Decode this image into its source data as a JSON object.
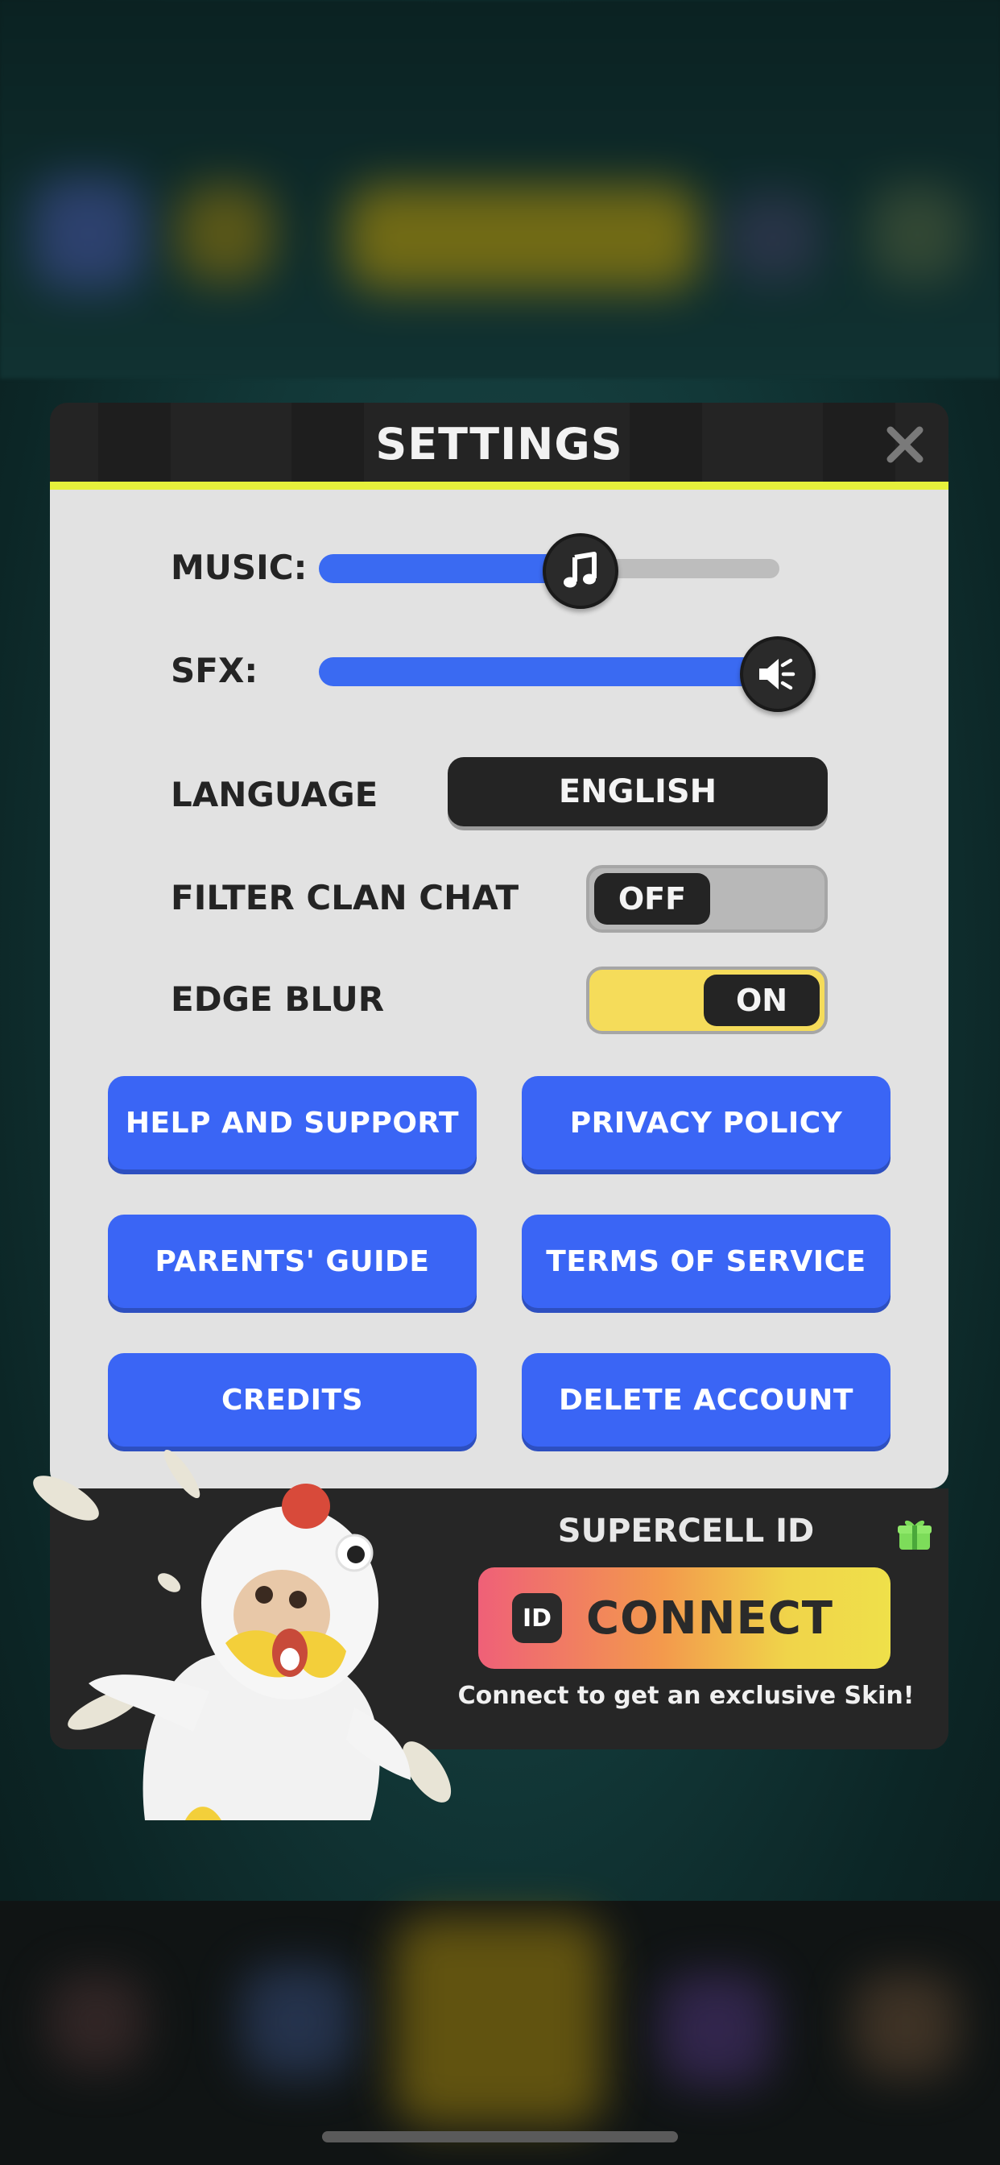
{
  "settings": {
    "title": "SETTINGS",
    "music": {
      "label": "MUSIC:",
      "level": 0.57
    },
    "sfx": {
      "label": "SFX:",
      "level": 1.0
    },
    "language": {
      "label": "LANGUAGE",
      "value": "ENGLISH"
    },
    "filter_clan_chat": {
      "label": "FILTER CLAN CHAT",
      "state": "OFF"
    },
    "edge_blur": {
      "label": "EDGE BLUR",
      "state": "ON"
    },
    "buttons": {
      "help": "HELP AND SUPPORT",
      "privacy": "PRIVACY POLICY",
      "parents": "PARENTS' GUIDE",
      "terms": "TERMS OF SERVICE",
      "credits": "CREDITS",
      "delete": "DELETE ACCOUNT"
    }
  },
  "supercell_id": {
    "title": "SUPERCELL ID",
    "badge": "ID",
    "connect_label": "CONNECT",
    "note": "Connect to get an exclusive Skin!"
  },
  "colors": {
    "accent_yellow": "#e6f03c",
    "button_blue": "#3a65f5",
    "slider_blue": "#3a6af2",
    "panel_dark": "#242424",
    "panel_light": "#e2e2e2",
    "toggle_on": "#f5dc5a",
    "gift_green": "#7ddc5a"
  }
}
